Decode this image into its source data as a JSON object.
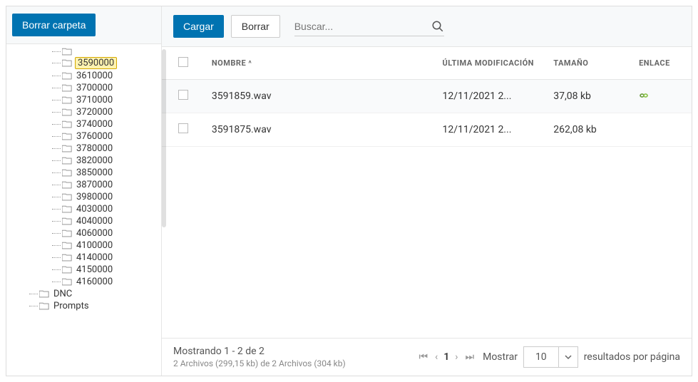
{
  "sidebar": {
    "deleteFolder": "Borrar carpeta",
    "folders": [
      "3590000",
      "3610000",
      "3700000",
      "3710000",
      "3720000",
      "3740000",
      "3760000",
      "3780000",
      "3820000",
      "3850000",
      "3870000",
      "3980000",
      "4030000",
      "4040000",
      "4060000",
      "4100000",
      "4140000",
      "4150000",
      "4160000"
    ],
    "selectedFolder": "3590000",
    "rootFolders": [
      "DNC",
      "Prompts"
    ]
  },
  "toolbar": {
    "upload": "Cargar",
    "delete": "Borrar",
    "searchPlaceholder": "Buscar..."
  },
  "table": {
    "headers": {
      "name": "NOMBRE",
      "modified": "ÚLTIMA MODIFICACIÓN",
      "size": "TAMAÑO",
      "link": "ENLACE"
    },
    "rows": [
      {
        "name": "3591859.wav",
        "modified": "12/11/2021 2...",
        "size": "37,08 kb",
        "hasLink": true
      },
      {
        "name": "3591875.wav",
        "modified": "12/11/2021 2...",
        "size": "262,08 kb",
        "hasLink": false
      }
    ]
  },
  "footer": {
    "showing": "Mostrando 1 - 2 de 2",
    "summary": "2 Archivos (299,15 kb) de 2 Archivos (304 kb)",
    "currentPage": "1",
    "showLabel": "Mostrar",
    "pageSize": "10",
    "resultsPerPage": "resultados por página"
  }
}
